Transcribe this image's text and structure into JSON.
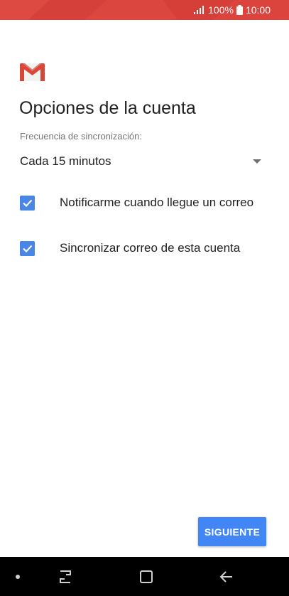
{
  "status_bar": {
    "battery_percent": "100%",
    "time": "10:00",
    "background_color": "#d9433b"
  },
  "app": {
    "logo_icon": "gmail-icon"
  },
  "main": {
    "title": "Opciones de la cuenta",
    "sync_frequency": {
      "label": "Frecuencia de sincronización:",
      "selected": "Cada 15 minutos"
    },
    "options": [
      {
        "label": "Notificarme cuando llegue un correo",
        "checked": true
      },
      {
        "label": "Sincronizar correo de esta cuenta",
        "checked": true
      }
    ],
    "accent_color": "#4285f4"
  },
  "footer": {
    "next_label": "SIGUIENTE"
  },
  "nav_bar": {
    "icons": [
      "recent-apps-icon",
      "home-icon",
      "back-icon"
    ]
  }
}
